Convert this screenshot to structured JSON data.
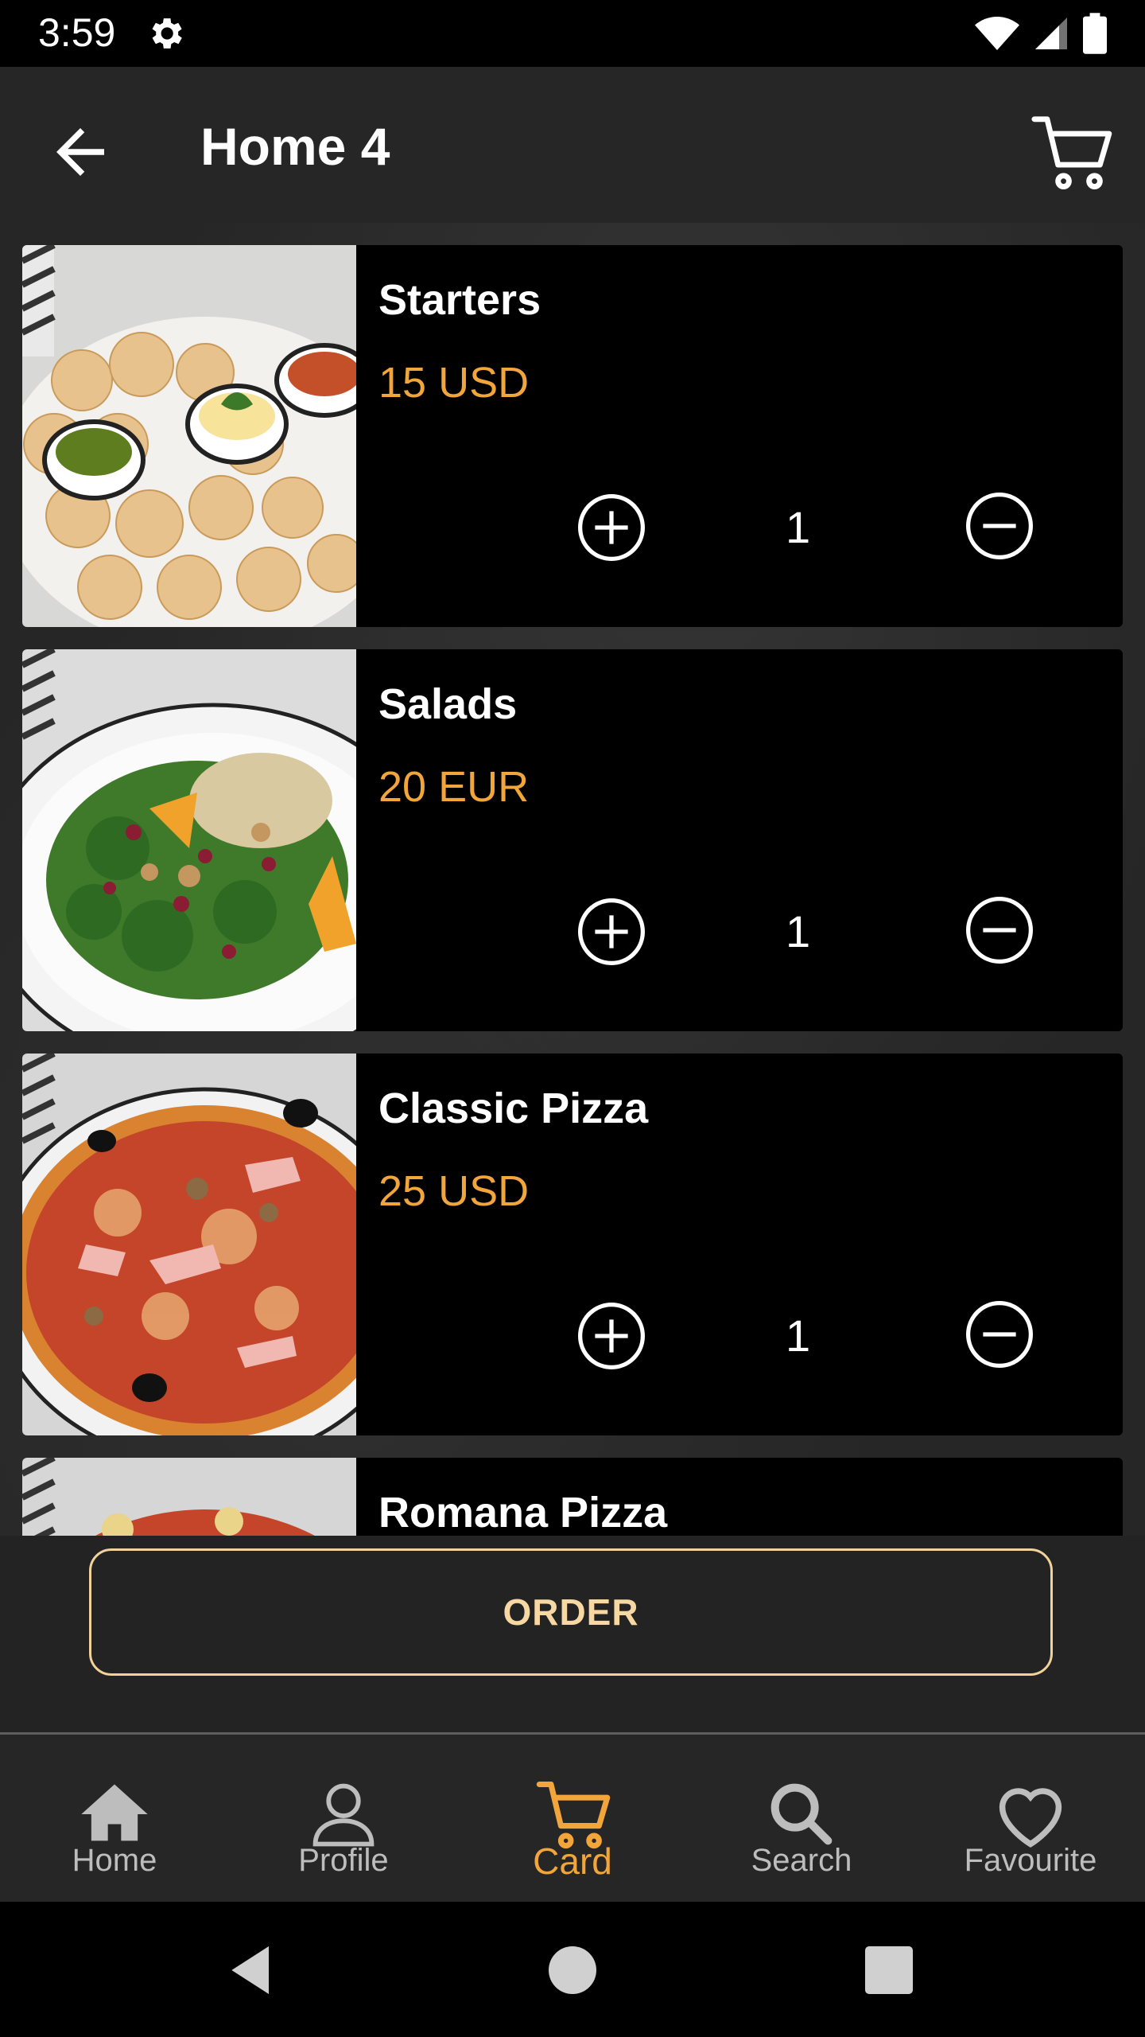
{
  "status_bar": {
    "time": "3:59"
  },
  "app_bar": {
    "title": "Home 4"
  },
  "items": [
    {
      "title": "Starters",
      "price": "15 USD",
      "quantity": "1"
    },
    {
      "title": "Salads",
      "price": "20 EUR",
      "quantity": "1"
    },
    {
      "title": "Classic Pizza",
      "price": "25 USD",
      "quantity": "1"
    },
    {
      "title": "Romana Pizza"
    }
  ],
  "order_button": {
    "label": "ORDER"
  },
  "bottom_nav": {
    "items": [
      {
        "label": "Home",
        "icon": "home-icon"
      },
      {
        "label": "Profile",
        "icon": "person-icon"
      },
      {
        "label": "Card",
        "icon": "cart-icon",
        "active": true
      },
      {
        "label": "Search",
        "icon": "search-icon"
      },
      {
        "label": "Favourite",
        "icon": "heart-icon"
      }
    ]
  },
  "colors": {
    "accent": "#f2a53a",
    "order_border": "#f1d39a",
    "background": "#262626",
    "card": "#000000"
  }
}
